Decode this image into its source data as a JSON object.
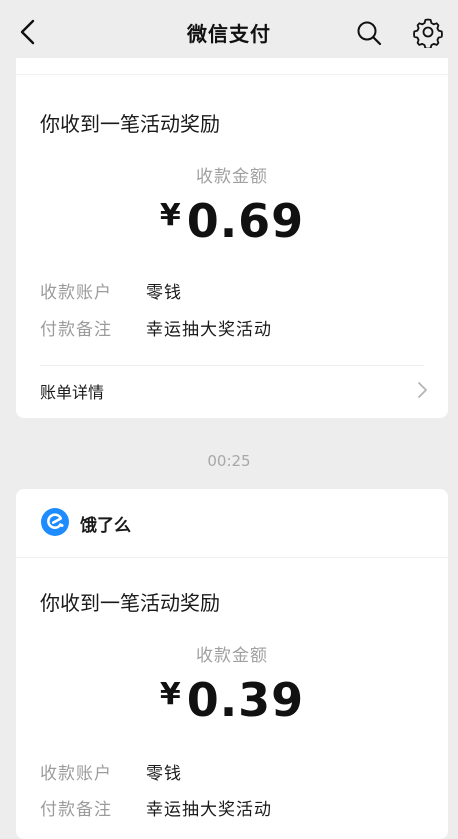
{
  "nav": {
    "title": "微信支付",
    "back_icon": "chevron-left-icon",
    "search_icon": "search-icon",
    "settings_icon": "gear-icon"
  },
  "messages": [
    {
      "title": "你收到一笔活动奖励",
      "amount_label": "收款金额",
      "currency": "¥",
      "amount": "0.69",
      "rows": [
        {
          "label": "收款账户",
          "value": "零钱"
        },
        {
          "label": "付款备注",
          "value": "幸运抽大奖活动"
        }
      ],
      "details_label": "账单详情"
    },
    {
      "merchant": {
        "name": "饿了么",
        "logo_icon": "eleme-logo-icon",
        "logo_color": "#1e8cff"
      },
      "title": "你收到一笔活动奖励",
      "amount_label": "收款金额",
      "currency": "¥",
      "amount": "0.39",
      "rows": [
        {
          "label": "收款账户",
          "value": "零钱"
        },
        {
          "label": "付款备注",
          "value": "幸运抽大奖活动"
        }
      ]
    }
  ],
  "timestamp": "00:25"
}
